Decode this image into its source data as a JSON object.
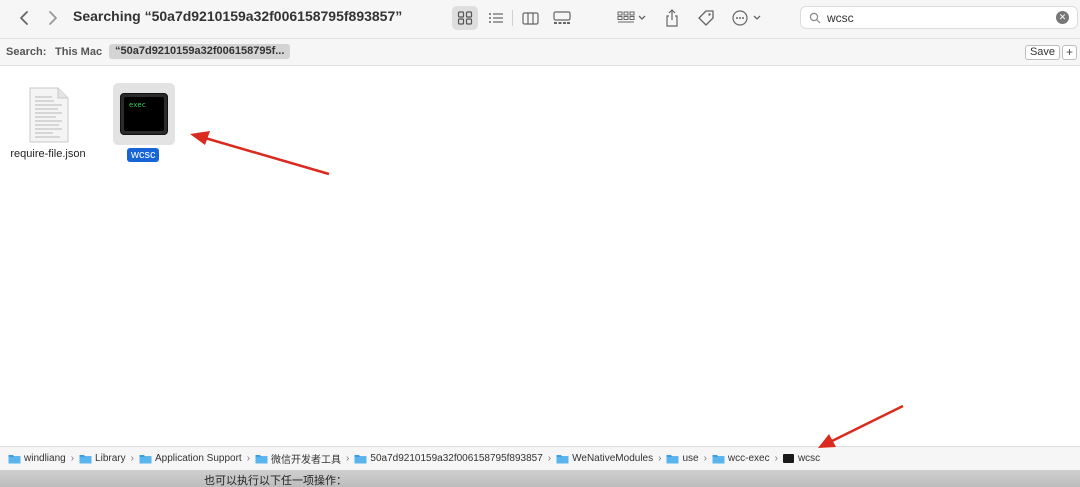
{
  "toolbar": {
    "back_icon": "chevron-left-icon",
    "forward_icon": "chevron-right-icon",
    "title": "Searching “50a7d9210159a32f006158795f893857”"
  },
  "search": {
    "value": "wcsc"
  },
  "scope": {
    "label": "Search:",
    "this_mac": "This Mac",
    "term": "“50a7d9210159a32f006158795f...",
    "save": "Save",
    "add": "+"
  },
  "files": [
    {
      "name": "require-file.json",
      "icon": "json-document-icon"
    },
    {
      "name": "wcsc",
      "icon": "unix-executable-icon",
      "icon_text": "exec",
      "selected": true
    }
  ],
  "path": [
    {
      "label": "windliang",
      "icon": "folder-icon"
    },
    {
      "label": "Library",
      "icon": "folder-icon"
    },
    {
      "label": "Application Support",
      "icon": "folder-icon"
    },
    {
      "label": "微信开发者工具",
      "icon": "folder-icon"
    },
    {
      "label": "50a7d9210159a32f006158795f893857",
      "icon": "folder-icon"
    },
    {
      "label": "WeNativeModules",
      "icon": "folder-icon"
    },
    {
      "label": "use",
      "icon": "folder-icon"
    },
    {
      "label": "wcc-exec",
      "icon": "folder-icon"
    },
    {
      "label": "wcsc",
      "icon": "terminal-icon"
    }
  ],
  "caption": "也可以执行以下任一项操作：",
  "colors": {
    "selection": "#1664d6",
    "annotation_arrow": "#d92b1f",
    "folder": "#3a9fe0"
  }
}
